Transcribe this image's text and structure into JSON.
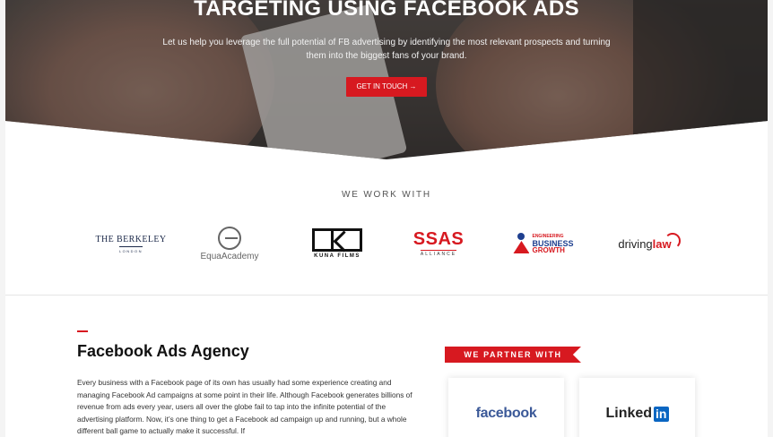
{
  "hero": {
    "title": "TARGETING USING FACEBOOK ADS",
    "subtitle": "Let us help you leverage the full potential of FB advertising by identifying the most relevant prospects and turning them into the biggest fans of your brand.",
    "cta_label": "GET IN TOUCH →"
  },
  "clients": {
    "heading": "WE WORK WITH",
    "logos": [
      {
        "name": "THE BERKELEY",
        "sub": "LONDON"
      },
      {
        "name": "EquaAcademy"
      },
      {
        "name": "KUNA FILMS"
      },
      {
        "name": "SSAS",
        "sub": "ALLIANCE"
      },
      {
        "line1": "ENGINEERING",
        "line2": "BUSINESS",
        "line3": "GROWTH"
      },
      {
        "name_part1": "driving",
        "name_part2": "law"
      }
    ]
  },
  "agency": {
    "title": "Facebook Ads Agency",
    "body": "Every business with a Facebook page of its own has usually had some experience creating and managing Facebook Ad campaigns at some point in their life. Although Facebook generates billions of revenue from ads every year, users all over the globe fail to tap into the infinite potential of the advertising platform. Now, it’s one thing to get a Facebook ad campaign up and running, but a whole different ball game to actually make it successful. If"
  },
  "partners": {
    "heading": "WE PARTNER WITH",
    "facebook": "facebook",
    "linkedin_text": "Linked",
    "linkedin_in": "in"
  },
  "colors": {
    "accent": "#d71920",
    "facebook_blue": "#3b5998",
    "linkedin_blue": "#0a66c2"
  }
}
